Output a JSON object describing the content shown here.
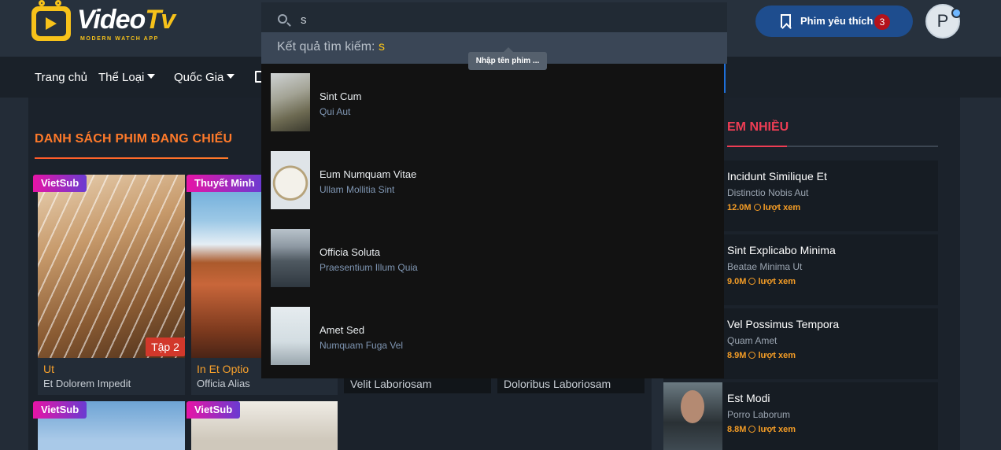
{
  "brand": {
    "name_part1": "Video",
    "name_part2": "Tv",
    "tagline": "MODERN WATCH APP"
  },
  "header": {
    "favorites_label": "Phim yêu thích",
    "favorites_count": "3",
    "avatar_initial": "P"
  },
  "nav": {
    "items": [
      "Trang chủ",
      "Thể Loại",
      "Quốc Gia"
    ]
  },
  "main": {
    "section_title": "DANH SÁCH PHIM ĐANG CHIẾU",
    "cards": [
      {
        "badge": "VietSub",
        "episode": "Tập 2",
        "title": "Ut",
        "subtitle": "Et Dolorem Impedit"
      },
      {
        "badge": "Thuyết Minh",
        "title": "In Et Optio",
        "subtitle": "Officia Alias"
      },
      {
        "subtitle": "Velit Laboriosam"
      },
      {
        "subtitle": "Doloribus Laboriosam"
      },
      {
        "badge": "VietSub"
      },
      {
        "badge": "VietSub"
      }
    ]
  },
  "sidebar": {
    "title": "EM NHIỀU",
    "views_suffix": "lượt xem",
    "items": [
      {
        "title": "Incidunt Similique Et",
        "subtitle": "Distinctio Nobis Aut",
        "views": "12.0M"
      },
      {
        "title": "Sint Explicabo Minima",
        "subtitle": "Beatae Minima Ut",
        "views": "9.0M"
      },
      {
        "title": "Vel Possimus Tempora",
        "subtitle": "Quam Amet",
        "views": "8.9M"
      },
      {
        "title": "Est Modi",
        "subtitle": "Porro Laborum",
        "views": "8.8M"
      }
    ]
  },
  "search": {
    "query": "s",
    "results_label": "Kết quả tìm kiếm:",
    "tooltip": "Nhập tên phim ...",
    "results": [
      {
        "title": "Sint Cum",
        "subtitle": "Qui Aut"
      },
      {
        "title": "Eum Numquam Vitae",
        "subtitle": "Ullam Mollitia Sint"
      },
      {
        "title": "Officia Soluta",
        "subtitle": "Praesentium Illum Quia"
      },
      {
        "title": "Amet Sed",
        "subtitle": "Numquam Fuga Vel"
      }
    ]
  }
}
